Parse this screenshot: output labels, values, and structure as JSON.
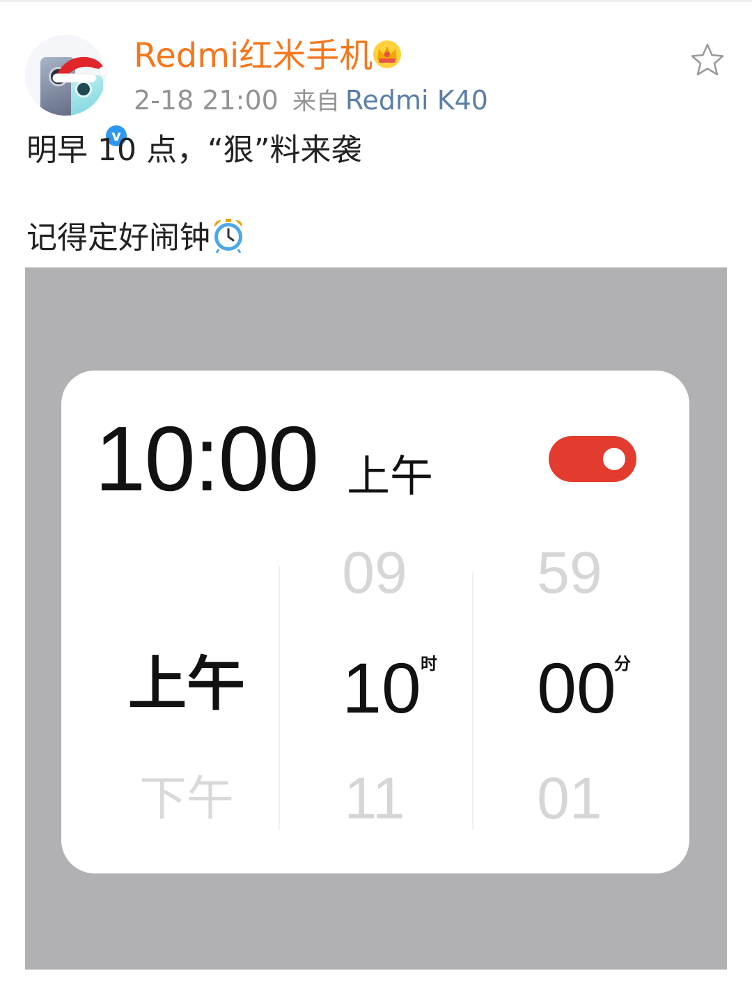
{
  "post": {
    "username": "Redmi红米手机",
    "timestamp": "2-18 21:00",
    "source_prefix": "来自",
    "source_device": "Redmi K40",
    "text_line1": "明早 10 点，“狠”料来袭",
    "text_line2": "记得定好闹钟",
    "icons": {
      "avatar": "avatar",
      "verified": "verified-badge-icon",
      "crown": "crown-icon",
      "favorite": "star-icon",
      "alarm_emoji": "alarm-clock-icon"
    },
    "colors": {
      "username": "#f5771d",
      "device_link": "#5a7fa8",
      "verified": "#2e98f0"
    }
  },
  "alarm_image": {
    "time": "10:00",
    "ampm": "上午",
    "toggle_on": true,
    "toggle_color": "#e33c2f",
    "picker": {
      "ampm_selected": "上午",
      "ampm_next": "下午",
      "hour_prev": "09",
      "hour_selected": "10",
      "hour_unit": "时",
      "hour_next": "11",
      "minute_prev": "59",
      "minute_selected": "00",
      "minute_unit": "分",
      "minute_next": "01"
    }
  }
}
